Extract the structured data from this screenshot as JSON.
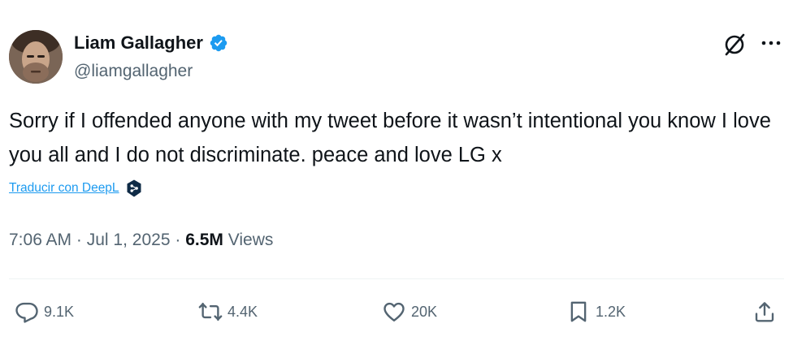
{
  "author": {
    "display_name": "Liam Gallagher",
    "handle": "@liamgallagher",
    "verified": true
  },
  "tweet": {
    "text": "Sorry if I offended anyone with my tweet before it wasn’t intentional you know I love you all and I do not discriminate. peace and love LG x",
    "translate_label": "Traducir con DeepL"
  },
  "meta": {
    "time": "7:06 AM",
    "separator": "·",
    "date": "Jul 1, 2025",
    "views_count": "6.5M",
    "views_label": "Views"
  },
  "actions": {
    "replies": "9.1K",
    "reposts": "4.4K",
    "likes": "20K",
    "bookmarks": "1.2K"
  },
  "icons": {
    "header": [
      "grok-icon",
      "more-icon"
    ],
    "actions": [
      "reply-icon",
      "repost-icon",
      "like-icon",
      "bookmark-icon",
      "share-icon"
    ]
  },
  "colors": {
    "text": "#0f1419",
    "secondary": "#536471",
    "verified": "#1d9bf0",
    "link": "#1d9bf0",
    "deepl": "#0f2b46"
  }
}
